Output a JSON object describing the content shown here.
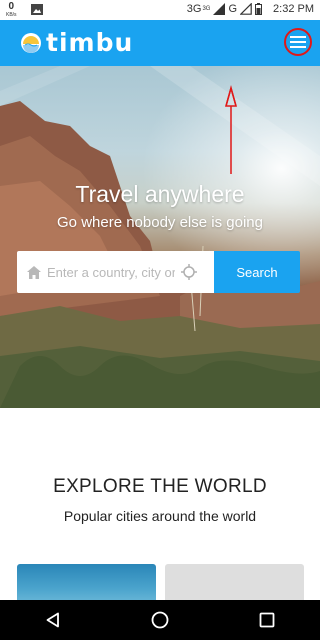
{
  "status_bar": {
    "net_speed_value": "0",
    "net_speed_unit": "KB/s",
    "network_type": "3G",
    "network_sup": "3G",
    "carrier_letter": "G",
    "time": "2:32 PM"
  },
  "header": {
    "logo_text": "timbu"
  },
  "hero": {
    "title": "Travel anywhere",
    "subtitle": "Go where nobody else is going",
    "search": {
      "placeholder": "Enter a country, city or place",
      "button_label": "Search"
    }
  },
  "explore": {
    "title": "EXPLORE THE WORLD",
    "subtitle": "Popular cities around the world"
  },
  "icons": {
    "menu": "hamburger-menu-icon",
    "home": "home-icon",
    "locate": "crosshair-icon",
    "back": "back-triangle-icon",
    "home_nav": "circle-home-icon",
    "recents": "square-recents-icon"
  },
  "colors": {
    "brand": "#1aa3f0",
    "annotation": "#e01818"
  }
}
